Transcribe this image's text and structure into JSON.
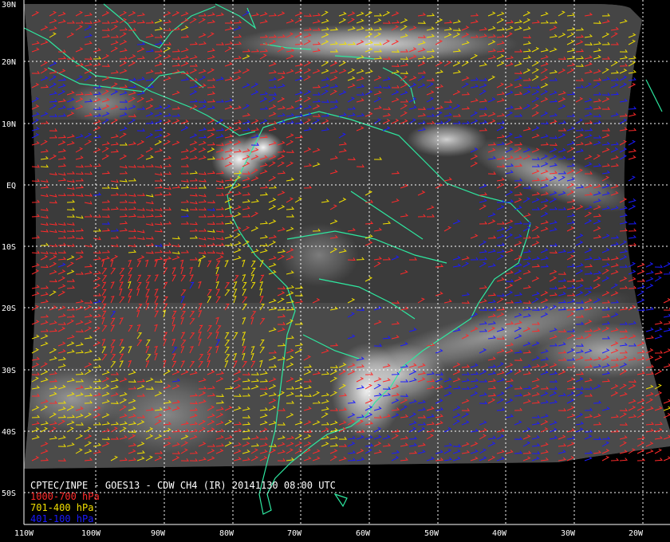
{
  "map": {
    "lat_labels": [
      "30N",
      "20N",
      "10N",
      "EQ",
      "10S",
      "20S",
      "30S",
      "40S",
      "50S"
    ],
    "lon_labels": [
      "110W",
      "100W",
      "90W",
      "80W",
      "70W",
      "60W",
      "50W",
      "40W",
      "30W",
      "20W"
    ],
    "colors": {
      "coastline": "#2ee8a0",
      "grid": "#ffffff",
      "low_level_wind": "#ff2a2a",
      "mid_level_wind": "#f2e000",
      "high_level_wind": "#1a1aff",
      "satellite_background": "#3a3a3a"
    }
  },
  "caption": {
    "title": "CPTEC/INPE - GOES13 - CDW CH4 (IR) 20141130 08:00 UTC",
    "legend_low": "1000-700 hPa",
    "legend_mid": "701-400 hPa",
    "legend_high": "401-100 hPa"
  }
}
